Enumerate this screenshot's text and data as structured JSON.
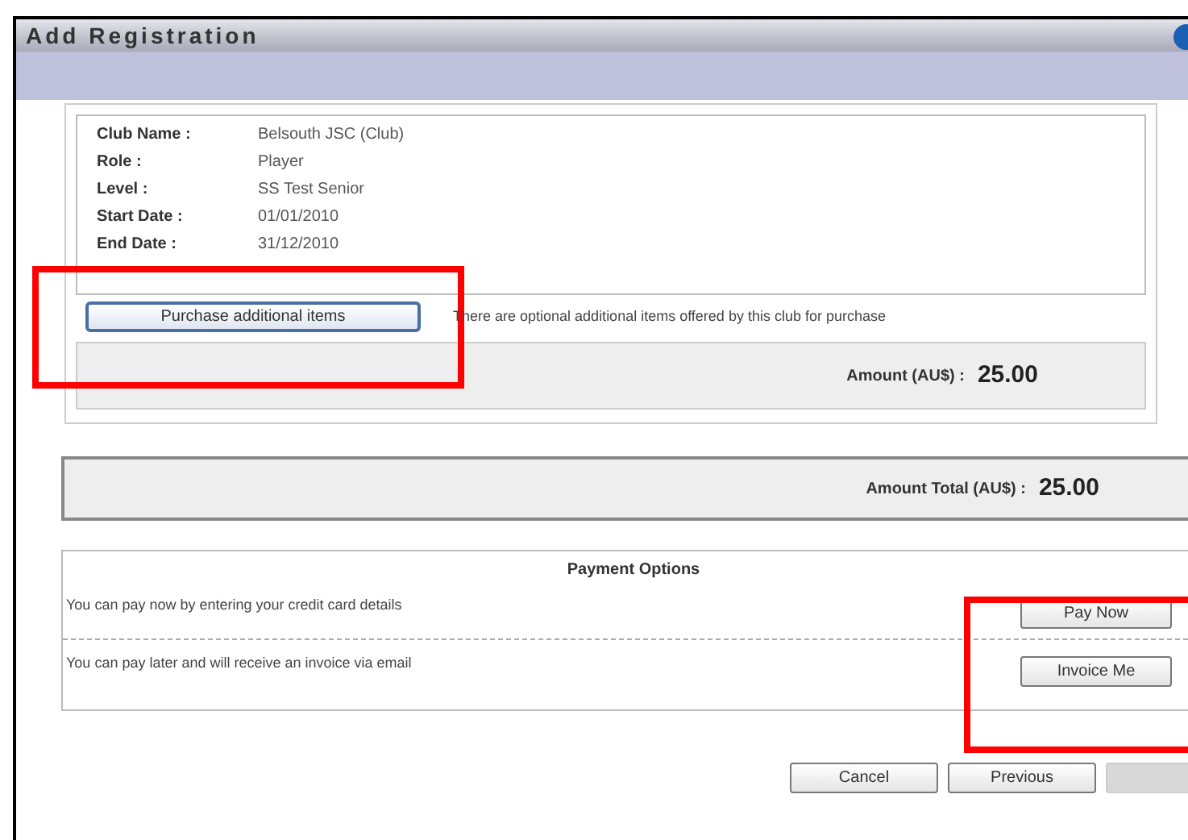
{
  "window": {
    "title": "Add Registration"
  },
  "details": [
    {
      "label": "Club Name :",
      "value": "Belsouth JSC (Club)"
    },
    {
      "label": "Role :",
      "value": "Player"
    },
    {
      "label": "Level :",
      "value": "SS Test Senior"
    },
    {
      "label": "Start Date :",
      "value": "01/01/2010"
    },
    {
      "label": "End Date :",
      "value": "31/12/2010"
    }
  ],
  "purchase": {
    "button": "Purchase additional items",
    "note": "There are optional additional items offered by this club for purchase"
  },
  "amount": {
    "label": "Amount (AU$) :",
    "value": "25.00"
  },
  "total": {
    "label": "Amount Total (AU$) :",
    "value": "25.00"
  },
  "payment": {
    "title": "Payment Options",
    "options": [
      {
        "text": "You can pay now by entering your credit card details",
        "button": "Pay Now"
      },
      {
        "text": "You can pay later and will receive an invoice via email",
        "button": "Invoice Me"
      }
    ]
  },
  "footer": [
    {
      "label": "Cancel",
      "disabled": false
    },
    {
      "label": "Previous",
      "disabled": false
    },
    {
      "disabled": true
    }
  ]
}
